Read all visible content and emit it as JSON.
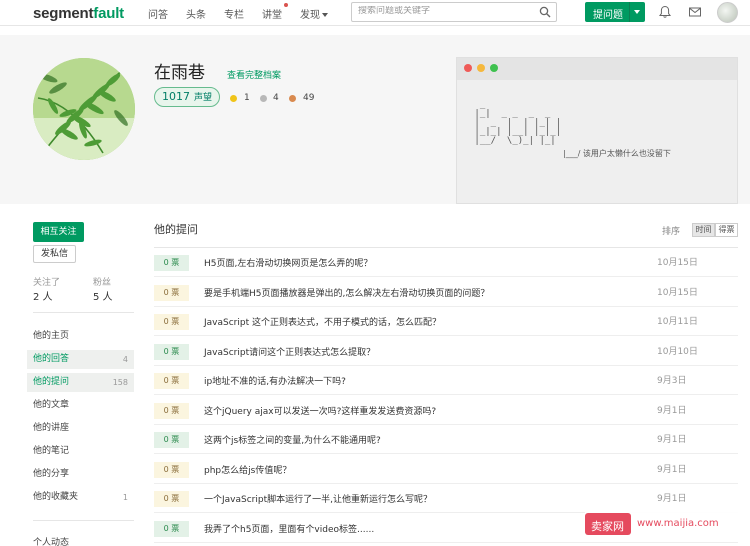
{
  "header": {
    "logo_a": "segment",
    "logo_b": "fault",
    "nav": [
      "问答",
      "头条",
      "专栏",
      "讲堂",
      "发现"
    ],
    "search_placeholder": "搜索问题或关键字",
    "ask_label": "提问题"
  },
  "profile": {
    "name": "在雨巷",
    "full_link": "查看完整档案",
    "reputation": "1017",
    "reputation_unit": "声望",
    "badges": {
      "gold": "1",
      "silver": "4",
      "bronze": "49"
    },
    "terminal_ascii": "  _\n |_|  _ _  _  _\n |  _  |  | |_| |\n |_|_| |__| |_|_|\n |__/  \\_)_| |_|",
    "terminal_msg": "|___/  该用户太懒什么也没留下"
  },
  "sidebar": {
    "follow": "相互关注",
    "message": "发私信",
    "following_label": "关注了",
    "following_val": "2 人",
    "fans_label": "粉丝",
    "fans_val": "5 人",
    "items": [
      {
        "label": "他的主页",
        "count": ""
      },
      {
        "label": "他的回答",
        "count": "4"
      },
      {
        "label": "他的提问",
        "count": "158"
      },
      {
        "label": "他的文章",
        "count": ""
      },
      {
        "label": "他的讲座",
        "count": ""
      },
      {
        "label": "他的笔记",
        "count": ""
      },
      {
        "label": "他的分享",
        "count": ""
      },
      {
        "label": "他的收藏夹",
        "count": "1"
      },
      {
        "label": "个人动态",
        "count": ""
      }
    ]
  },
  "main": {
    "title": "他的提问",
    "sort_label": "排序",
    "sort_time": "时间",
    "sort_votes": "得票",
    "questions": [
      {
        "votes": "0 票",
        "title": "H5页面,左右滑动切换网页是怎么弄的呢？",
        "date": "10月15日",
        "state": "answered"
      },
      {
        "votes": "0 票",
        "title": "要是手机端H5页面播放器是弹出的,怎么解决左右滑动切换页面的问题？",
        "date": "10月15日",
        "state": "unanswered"
      },
      {
        "votes": "0 票",
        "title": "JavaScript 这个正则表达式，不用子模式的话，怎么匹配？",
        "date": "10月11日",
        "state": "unanswered"
      },
      {
        "votes": "0 票",
        "title": "JavaScript请问这个正则表达式怎么提取？",
        "date": "10月10日",
        "state": "answered"
      },
      {
        "votes": "0 票",
        "title": "ip地址不准的话,有办法解决一下吗?",
        "date": "9月3日",
        "state": "unanswered"
      },
      {
        "votes": "0 票",
        "title": "这个jQuery ajax可以发送一次吗?这样重发发送费资源吗?",
        "date": "9月1日",
        "state": "unanswered"
      },
      {
        "votes": "0 票",
        "title": "这两个js标签之间的变量,为什么不能通用呢?",
        "date": "9月1日",
        "state": "answered"
      },
      {
        "votes": "0 票",
        "title": "php怎么给js传值呢？",
        "date": "9月1日",
        "state": "unanswered"
      },
      {
        "votes": "0 票",
        "title": "一个JavaScript脚本运行了一半,让他重新运行怎么写呢？",
        "date": "9月1日",
        "state": "unanswered"
      },
      {
        "votes": "0 票",
        "title": "我弄了个h5页面，里面有个video标签......",
        "date": "",
        "state": "answered"
      }
    ]
  },
  "watermark": {
    "logo": "卖家网",
    "url": "www.maijia.com"
  },
  "colors": {
    "brand": "#009a61",
    "answered_bg": "#e3f1e7",
    "unanswered_bg": "#fbf5df"
  }
}
